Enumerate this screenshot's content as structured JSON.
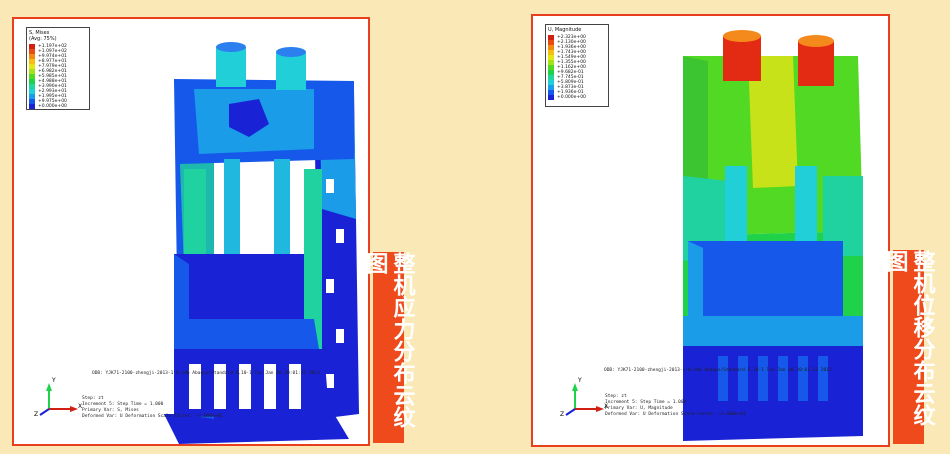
{
  "left_panel": {
    "legend": {
      "title": "S, Mises",
      "subtitle": "(Avg: 75%)",
      "entries": [
        {
          "value": "+1.197e+02",
          "color": "#d11f14"
        },
        {
          "value": "+1.097e+02",
          "color": "#e94c13"
        },
        {
          "value": "+9.974e+01",
          "color": "#f08a12"
        },
        {
          "value": "+8.977e+01",
          "color": "#f3c011"
        },
        {
          "value": "+7.979e+01",
          "color": "#e5e512"
        },
        {
          "value": "+6.982e+01",
          "color": "#a4e31b"
        },
        {
          "value": "+5.985e+01",
          "color": "#52d923"
        },
        {
          "value": "+4.988e+01",
          "color": "#1fd24a"
        },
        {
          "value": "+3.990e+01",
          "color": "#20d69b"
        },
        {
          "value": "+2.993e+01",
          "color": "#21cfd8"
        },
        {
          "value": "+1.995e+01",
          "color": "#1a9ce8"
        },
        {
          "value": "+9.975e+00",
          "color": "#1558ea"
        },
        {
          "value": "+0.000e+00",
          "color": "#1a22d6"
        }
      ]
    },
    "odb_line": "ODB: YJK71-2100-zhengji-2013-1-8.odb    Abaqus/Standard 6.10-1    Tue Jan 08 20:01:12 2013",
    "footer": {
      "step": "Step: zt",
      "increment": "Increment    5: Step Time =    1.000",
      "primary": "Primary Var: S, Mises",
      "deformed": "Deformed Var: U   Deformation Scale Factor: +1.000e+01"
    },
    "triad": {
      "x": "X",
      "y": "Y",
      "z": "Z"
    }
  },
  "right_panel": {
    "legend": {
      "title": "U, Magnitude",
      "subtitle": "",
      "entries": [
        {
          "value": "+2.323e+00",
          "color": "#d11f14"
        },
        {
          "value": "+2.130e+00",
          "color": "#e94c13"
        },
        {
          "value": "+1.936e+00",
          "color": "#f08a12"
        },
        {
          "value": "+1.743e+00",
          "color": "#f3c011"
        },
        {
          "value": "+1.549e+00",
          "color": "#e5e512"
        },
        {
          "value": "+1.355e+00",
          "color": "#a4e31b"
        },
        {
          "value": "+1.162e+00",
          "color": "#52d923"
        },
        {
          "value": "+9.682e-01",
          "color": "#1fd24a"
        },
        {
          "value": "+7.745e-01",
          "color": "#20d69b"
        },
        {
          "value": "+5.809e-01",
          "color": "#21cfd8"
        },
        {
          "value": "+3.873e-01",
          "color": "#1a9ce8"
        },
        {
          "value": "+1.936e-01",
          "color": "#1558ea"
        },
        {
          "value": "+0.000e+00",
          "color": "#1a22d6"
        }
      ]
    },
    "odb_line": "ODB: YJK71-2100-zhengji-2013-1-8.odb    Abaqus/Standard 6.10-1    Tue Jan 08 20:01:12 2013",
    "footer": {
      "step": "Step: zt",
      "increment": "Increment    5: Step Time =    1.000",
      "primary": "Primary Var: U, Magnitude",
      "deformed": "Deformed Var: U   Deformation Scale Factor: +1.000e+01"
    },
    "triad": {
      "x": "X",
      "y": "Y",
      "z": "Z"
    }
  },
  "labels": {
    "left": "整机应力分布云纹图",
    "right": "整机位移分布云纹图"
  },
  "colors": {
    "background": "#fbe8b7",
    "frame_border": "#e8401e",
    "label_bg": "#ee4a1c"
  }
}
